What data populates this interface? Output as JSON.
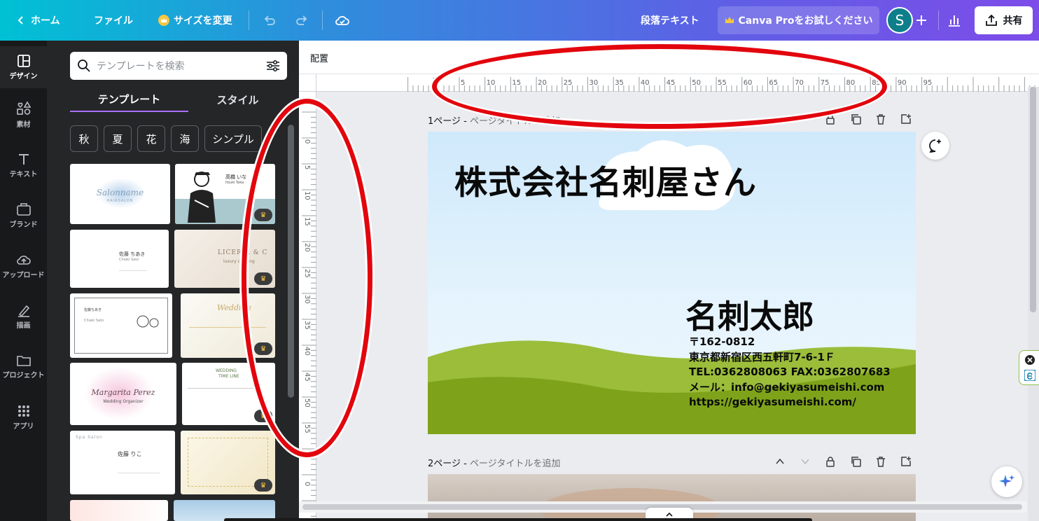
{
  "topbar": {
    "home_label": "ホーム",
    "file_label": "ファイル",
    "resize_label": "サイズを変更",
    "text_type_label": "段落テキスト",
    "try_pro_label": "Canva Proをお試しください",
    "avatar_initial": "S",
    "share_label": "共有"
  },
  "rail": {
    "items": [
      {
        "label": "デザイン",
        "icon": "layout-icon"
      },
      {
        "label": "素材",
        "icon": "elements-icon"
      },
      {
        "label": "テキスト",
        "icon": "text-icon"
      },
      {
        "label": "ブランド",
        "icon": "brand-icon"
      },
      {
        "label": "アップロード",
        "icon": "upload-cloud-icon"
      },
      {
        "label": "描画",
        "icon": "draw-icon"
      },
      {
        "label": "プロジェクト",
        "icon": "folder-icon"
      },
      {
        "label": "アプリ",
        "icon": "apps-grid-icon"
      }
    ]
  },
  "panel": {
    "search_placeholder": "テンプレートを検索",
    "tabs": [
      "テンプレート",
      "スタイル"
    ],
    "chips": [
      "秋",
      "夏",
      "花",
      "海",
      "シンプル"
    ],
    "templates": [
      {
        "line1": "Salonname",
        "line2": "HAIRSALON"
      },
      {
        "line1": "高橋 いな",
        "line2": "Itsuki Taka"
      },
      {
        "line1": "佐藤 ちあき",
        "line2": "Chiaki Sato"
      },
      {
        "line1": "LICERIA & C",
        "line2": "luxury clothing"
      },
      {
        "line1": "佐藤ちあき",
        "line2": "Chiaki Sato"
      },
      {
        "line1": "Wedding",
        "line2": ""
      },
      {
        "line1": "Margarita Perez",
        "line2": "Wedding Organizer"
      },
      {
        "line1": "WEDDING",
        "line2": "TIME LINE"
      },
      {
        "line1": "Spa Salon",
        "line2": "佐藤 りこ"
      },
      {
        "line1": "",
        "line2": ""
      }
    ]
  },
  "toolbar2": {
    "arrange_label": "配置"
  },
  "ruler": {
    "h_ticks": [
      "5",
      "10",
      "15",
      "20",
      "25",
      "30",
      "35",
      "40",
      "45",
      "50",
      "55",
      "60",
      "65",
      "70",
      "75",
      "80",
      "85",
      "90",
      "95"
    ],
    "v_ticks": [
      "0",
      "5",
      "10",
      "15",
      "20",
      "25",
      "30",
      "35",
      "40",
      "45",
      "50",
      "55",
      "60",
      "0"
    ]
  },
  "pages": [
    {
      "prefix": "1ページ - ",
      "title_placeholder": "ページタイトルを追加",
      "card": {
        "company": "株式会社名刺屋さん",
        "name": "名刺太郎",
        "postal": "〒162-0812",
        "address": "東京都新宿区西五軒町7-6-1Ｆ",
        "tel_fax": "TEL:0362808063 FAX:0362807683",
        "mail": "メール：info@gekiyasumeishi.com",
        "url": "https://gekiyasumeishi.com/"
      }
    },
    {
      "prefix": "2ページ - ",
      "title_placeholder": "ページタイトルを追加"
    }
  ],
  "colors": {
    "annotation_ring": "#e3050d",
    "card_grass": "#7ea31a",
    "card_grass_light": "#9bbd3a",
    "panel_bg": "#252627",
    "rail_bg": "#18191b"
  }
}
